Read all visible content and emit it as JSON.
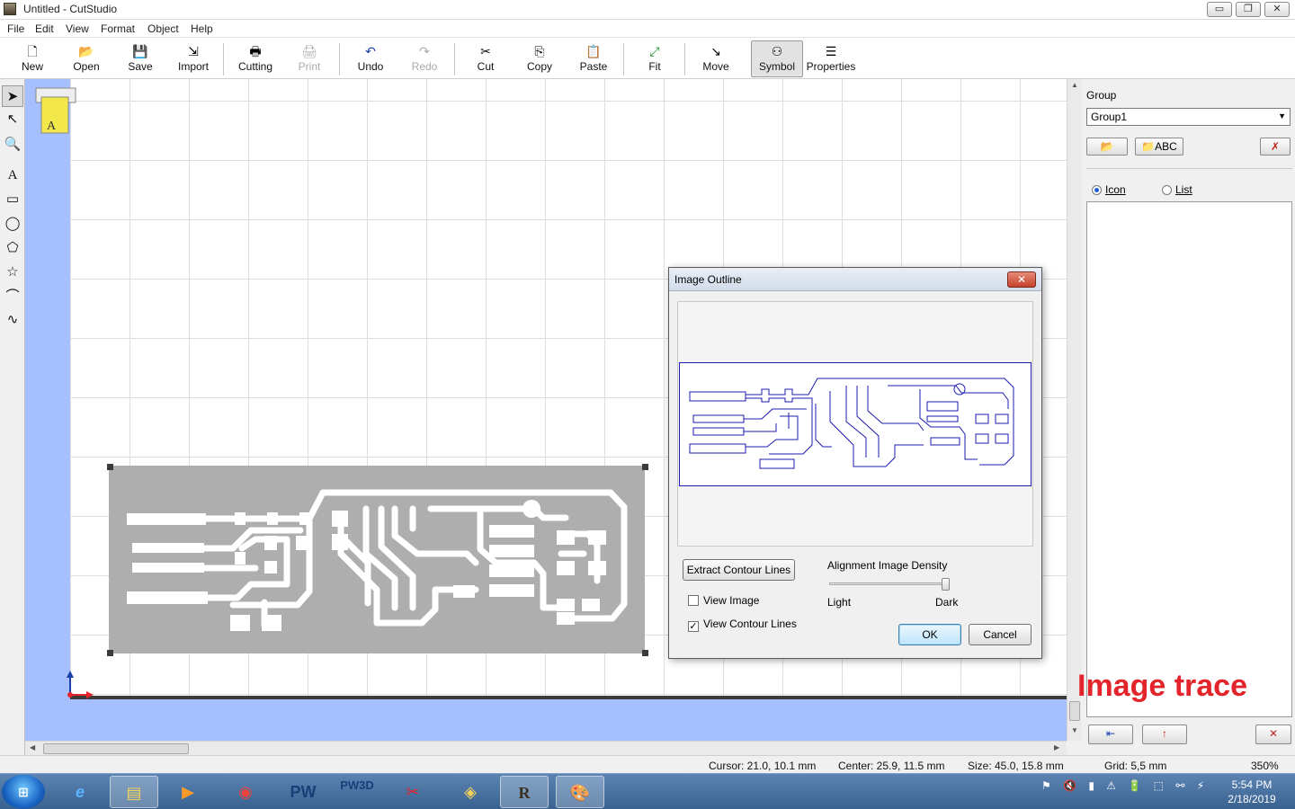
{
  "window": {
    "title": "Untitled - CutStudio",
    "min_label": "▭",
    "restore_label": "❐",
    "close_label": "✕"
  },
  "menu": [
    "File",
    "Edit",
    "View",
    "Format",
    "Object",
    "Help"
  ],
  "toolbar": [
    {
      "name": "new",
      "label": "New",
      "icon": "🗋",
      "enabled": true
    },
    {
      "name": "open",
      "label": "Open",
      "icon": "📂",
      "enabled": true
    },
    {
      "name": "save",
      "label": "Save",
      "icon": "💾",
      "enabled": true
    },
    {
      "name": "import",
      "label": "Import",
      "icon": "⇲",
      "enabled": true
    },
    {
      "name": "cutting",
      "label": "Cutting",
      "icon": "🖶",
      "enabled": true
    },
    {
      "name": "print",
      "label": "Print",
      "icon": "🖨",
      "enabled": false
    },
    {
      "name": "undo",
      "label": "Undo",
      "icon": "↶",
      "enabled": true
    },
    {
      "name": "redo",
      "label": "Redo",
      "icon": "↷",
      "enabled": false
    },
    {
      "name": "cut",
      "label": "Cut",
      "icon": "✂",
      "enabled": true
    },
    {
      "name": "copy",
      "label": "Copy",
      "icon": "⎘",
      "enabled": true
    },
    {
      "name": "paste",
      "label": "Paste",
      "icon": "📋",
      "enabled": true
    },
    {
      "name": "fit",
      "label": "Fit",
      "icon": "⤢",
      "enabled": true
    },
    {
      "name": "move",
      "label": "Move",
      "icon": "↘",
      "enabled": true
    },
    {
      "name": "symbol",
      "label": "Symbol",
      "icon": "⚇",
      "enabled": true,
      "active": true
    },
    {
      "name": "properties",
      "label": "Properties",
      "icon": "☰",
      "enabled": true
    }
  ],
  "left_tools": [
    {
      "name": "select-arrow",
      "icon": "➤",
      "selected": true
    },
    {
      "name": "edit-points",
      "icon": "↖"
    },
    {
      "name": "zoom",
      "icon": "🔍"
    },
    {
      "name": "text",
      "icon": "A"
    },
    {
      "name": "rectangle",
      "icon": "▭"
    },
    {
      "name": "ellipse",
      "icon": "◯"
    },
    {
      "name": "polygon",
      "icon": "⬠"
    },
    {
      "name": "star",
      "icon": "☆"
    },
    {
      "name": "polyline",
      "icon": "⌒"
    },
    {
      "name": "curve",
      "icon": "∿"
    }
  ],
  "right_panel": {
    "group_label": "Group",
    "group_value": "Group1",
    "text_button": "ABC",
    "view_icon_label": "Icon",
    "view_list_label": "List",
    "view_selected": "Icon"
  },
  "annotation": "Image trace",
  "dialog": {
    "title": "Image Outline",
    "close_label": "✕",
    "extract_button": "Extract Contour Lines",
    "density_label": "Alignment Image Density",
    "density_light": "Light",
    "density_dark": "Dark",
    "density_value": 0.97,
    "view_image_label": "View Image",
    "view_image_checked": false,
    "view_contour_label": "View Contour Lines",
    "view_contour_checked": true,
    "ok_label": "OK",
    "cancel_label": "Cancel"
  },
  "status": {
    "cursor": "Cursor: 21.0, 10.1 mm",
    "center": "Center: 25.9, 11.5 mm",
    "size": "Size: 45.0, 15.8 mm",
    "grid": "Grid: 5,5 mm",
    "zoom": "350%"
  },
  "taskbar": {
    "start_label": "⊞",
    "items": [
      {
        "name": "internet-explorer",
        "label": "e",
        "open": false
      },
      {
        "name": "file-explorer",
        "label": "▤",
        "open": true
      },
      {
        "name": "media-player",
        "label": "▶",
        "open": false
      },
      {
        "name": "chrome",
        "label": "◉",
        "open": false
      },
      {
        "name": "pw",
        "label": "PW",
        "open": false
      },
      {
        "name": "pw3d",
        "label": "PW3D",
        "open": false
      },
      {
        "name": "scissors-app",
        "label": "✂",
        "open": false
      },
      {
        "name": "cutting-app",
        "label": "◈",
        "open": false
      },
      {
        "name": "cutstudio",
        "label": "R",
        "open": true
      },
      {
        "name": "paint",
        "label": "🎨",
        "open": true
      }
    ],
    "tray_icons": "⚑ 🔇 ▮ ⚠ 🔋 ⬚ ⚯ ⚡",
    "time": "5:54 PM",
    "date": "2/18/2019"
  },
  "colors": {
    "accent": "#1e5fd0",
    "annotation": "#e3242b",
    "canvas_bg": "#a5bfff",
    "pcb_fill": "#aeaeae",
    "contour": "#1b1bb0"
  }
}
